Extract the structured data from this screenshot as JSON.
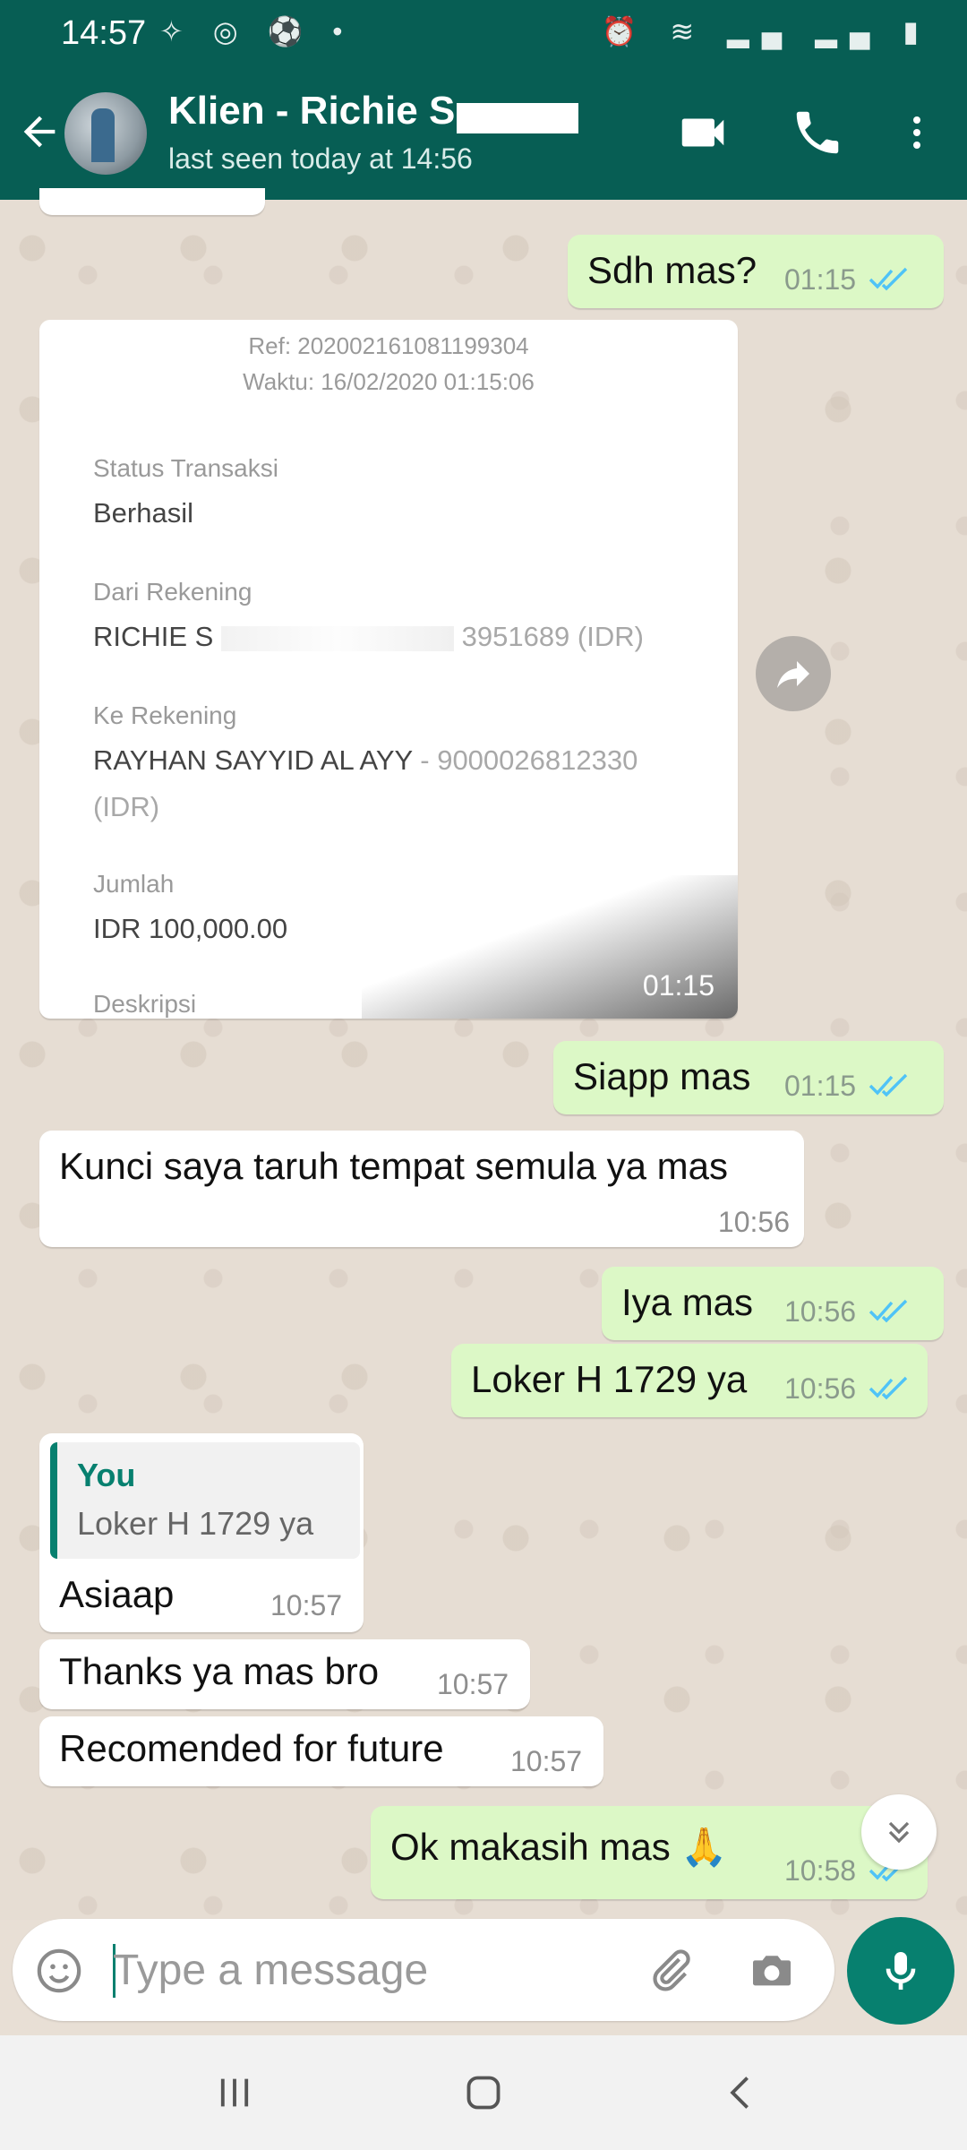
{
  "status_bar": {
    "time": "14:57"
  },
  "header": {
    "contact_name": "Klien - Richie S",
    "last_seen": "last seen today at 14:56"
  },
  "messages": {
    "m1": {
      "text": "Sdh mas?",
      "time": "01:15"
    },
    "receipt": {
      "ref": "Ref: 202002161081199304",
      "waktu": "Waktu: 16/02/2020 01:15:06",
      "status_label": "Status Transaksi",
      "status_value": "Berhasil",
      "dari_label": "Dari Rekening",
      "dari_value_a": "RICHIE S",
      "dari_value_b": "3951689 (IDR)",
      "ke_label": "Ke Rekening",
      "ke_name": "RAYHAN SAYYID AL AYY",
      "ke_account": " - 9000026812330",
      "ke_currency": "(IDR)",
      "jumlah_label": "Jumlah",
      "jumlah_value": "IDR 100,000.00",
      "deskripsi_label": "Deskripsi",
      "time": "01:15"
    },
    "m2": {
      "text": "Siapp mas",
      "time": "01:15"
    },
    "m3": {
      "text": "Kunci saya taruh tempat semula ya mas",
      "time": "10:56"
    },
    "m4": {
      "text": "Iya mas",
      "time": "10:56"
    },
    "m5": {
      "text": "Loker H 1729 ya",
      "time": "10:56"
    },
    "m6": {
      "quote_name": "You",
      "quote_text": "Loker H 1729 ya",
      "text": "Asiaap",
      "time": "10:57"
    },
    "m7": {
      "text": "Thanks ya mas bro",
      "time": "10:57"
    },
    "m8": {
      "text": "Recomended for future",
      "time": "10:57"
    },
    "m9": {
      "text": "Ok makasih mas 🙏",
      "time": "10:58"
    }
  },
  "input": {
    "placeholder": "Type a message"
  },
  "colors": {
    "header": "#075e54",
    "accent": "#07806f",
    "outgoing": "#dcf8c6",
    "read_ticks": "#4fc3f7"
  },
  "icons": [
    "back-arrow-icon",
    "video-call-icon",
    "phone-icon",
    "more-icon",
    "forward-icon",
    "emoji-icon",
    "attach-icon",
    "camera-icon",
    "mic-icon",
    "scroll-down-icon",
    "recents-icon",
    "home-icon",
    "back-icon"
  ]
}
